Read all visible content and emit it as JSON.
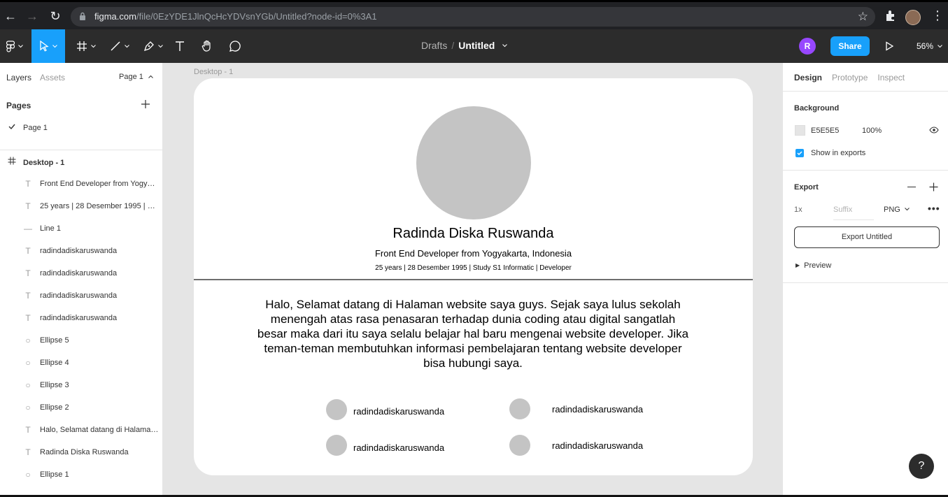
{
  "browser": {
    "url_host": "figma.com",
    "url_path": "/file/0EzYDE1JlnQcHcYDVsnYGb/Untitled?node-id=0%3A1"
  },
  "toolbar": {
    "breadcrumb_parent": "Drafts",
    "breadcrumb_separator": "/",
    "document_title": "Untitled",
    "avatar_initial": "R",
    "share_label": "Share",
    "zoom_level": "56%"
  },
  "left_panel": {
    "tab_layers": "Layers",
    "tab_assets": "Assets",
    "page_selector": "Page 1",
    "pages_heading": "Pages",
    "pages": [
      {
        "label": "Page 1",
        "selected": true
      }
    ],
    "frame_name": "Desktop - 1",
    "layers": [
      {
        "type": "text",
        "icon": "T",
        "label": "Front End Developer from Yogyakarta, Indonesia"
      },
      {
        "type": "text",
        "icon": "T",
        "label": "25 years | 28 Desember 1995 | Study S1 Informatic | Developer"
      },
      {
        "type": "line",
        "icon": "—",
        "label": "Line 1"
      },
      {
        "type": "text",
        "icon": "T",
        "label": "radindadiskaruswanda"
      },
      {
        "type": "text",
        "icon": "T",
        "label": "radindadiskaruswanda"
      },
      {
        "type": "text",
        "icon": "T",
        "label": "radindadiskaruswanda"
      },
      {
        "type": "text",
        "icon": "T",
        "label": "radindadiskaruswanda"
      },
      {
        "type": "ellipse",
        "icon": "○",
        "label": "Ellipse 5"
      },
      {
        "type": "ellipse",
        "icon": "○",
        "label": "Ellipse 4"
      },
      {
        "type": "ellipse",
        "icon": "○",
        "label": "Ellipse 3"
      },
      {
        "type": "ellipse",
        "icon": "○",
        "label": "Ellipse 2"
      },
      {
        "type": "text",
        "icon": "T",
        "label": "Halo, Selamat datang di Halaman website saya guys."
      },
      {
        "type": "text",
        "icon": "T",
        "label": "Radinda Diska Ruswanda"
      },
      {
        "type": "ellipse",
        "icon": "○",
        "label": "Ellipse 1"
      }
    ]
  },
  "canvas": {
    "frame_label": "Desktop - 1",
    "profile": {
      "name": "Radinda Diska Ruswanda",
      "role": "Front End Developer from Yogyakarta, Indonesia",
      "meta": "25 years | 28 Desember 1995 | Study S1 Informatic | Developer",
      "bio": "Halo, Selamat datang di Halaman website saya guys. Sejak saya lulus sekolah menengah atas rasa penasaran terhadap dunia coding atau digital sangatlah besar maka dari itu saya selalu belajar hal baru mengenai website developer. Jika teman-teman membutuhkan informasi pembelajaran tentang website developer bisa hubungi saya."
    },
    "contacts": [
      "radindadiskaruswanda",
      "radindadiskaruswanda",
      "radindadiskaruswanda",
      "radindadiskaruswanda"
    ]
  },
  "right_panel": {
    "tab_design": "Design",
    "tab_prototype": "Prototype",
    "tab_inspect": "Inspect",
    "background_heading": "Background",
    "background_hex": "E5E5E5",
    "background_opacity": "100%",
    "show_in_exports_label": "Show in exports",
    "export_heading": "Export",
    "export_scale": "1x",
    "export_suffix_placeholder": "Suffix",
    "export_format": "PNG",
    "export_button_label": "Export Untitled",
    "preview_label": "Preview"
  },
  "help_label": "?",
  "colors": {
    "figma_blue": "#18a0fb",
    "toolbar_bg": "#2c2c2c",
    "canvas_bg": "#e5e5e5",
    "placeholder_gray": "#c4c4c4",
    "avatar_purple": "#9747ff"
  }
}
